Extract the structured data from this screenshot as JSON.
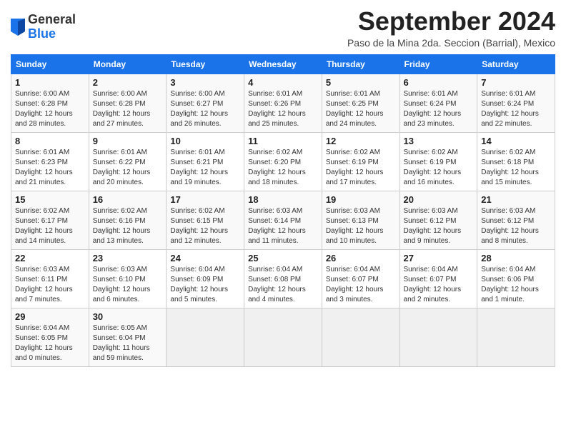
{
  "logo": {
    "general": "General",
    "blue": "Blue"
  },
  "title": "September 2024",
  "location": "Paso de la Mina 2da. Seccion (Barrial), Mexico",
  "days_of_week": [
    "Sunday",
    "Monday",
    "Tuesday",
    "Wednesday",
    "Thursday",
    "Friday",
    "Saturday"
  ],
  "weeks": [
    [
      {
        "day": "1",
        "sunrise": "6:00 AM",
        "sunset": "6:28 PM",
        "daylight": "12 hours and 28 minutes."
      },
      {
        "day": "2",
        "sunrise": "6:00 AM",
        "sunset": "6:28 PM",
        "daylight": "12 hours and 27 minutes."
      },
      {
        "day": "3",
        "sunrise": "6:00 AM",
        "sunset": "6:27 PM",
        "daylight": "12 hours and 26 minutes."
      },
      {
        "day": "4",
        "sunrise": "6:01 AM",
        "sunset": "6:26 PM",
        "daylight": "12 hours and 25 minutes."
      },
      {
        "day": "5",
        "sunrise": "6:01 AM",
        "sunset": "6:25 PM",
        "daylight": "12 hours and 24 minutes."
      },
      {
        "day": "6",
        "sunrise": "6:01 AM",
        "sunset": "6:24 PM",
        "daylight": "12 hours and 23 minutes."
      },
      {
        "day": "7",
        "sunrise": "6:01 AM",
        "sunset": "6:24 PM",
        "daylight": "12 hours and 22 minutes."
      }
    ],
    [
      {
        "day": "8",
        "sunrise": "6:01 AM",
        "sunset": "6:23 PM",
        "daylight": "12 hours and 21 minutes."
      },
      {
        "day": "9",
        "sunrise": "6:01 AM",
        "sunset": "6:22 PM",
        "daylight": "12 hours and 20 minutes."
      },
      {
        "day": "10",
        "sunrise": "6:01 AM",
        "sunset": "6:21 PM",
        "daylight": "12 hours and 19 minutes."
      },
      {
        "day": "11",
        "sunrise": "6:02 AM",
        "sunset": "6:20 PM",
        "daylight": "12 hours and 18 minutes."
      },
      {
        "day": "12",
        "sunrise": "6:02 AM",
        "sunset": "6:19 PM",
        "daylight": "12 hours and 17 minutes."
      },
      {
        "day": "13",
        "sunrise": "6:02 AM",
        "sunset": "6:19 PM",
        "daylight": "12 hours and 16 minutes."
      },
      {
        "day": "14",
        "sunrise": "6:02 AM",
        "sunset": "6:18 PM",
        "daylight": "12 hours and 15 minutes."
      }
    ],
    [
      {
        "day": "15",
        "sunrise": "6:02 AM",
        "sunset": "6:17 PM",
        "daylight": "12 hours and 14 minutes."
      },
      {
        "day": "16",
        "sunrise": "6:02 AM",
        "sunset": "6:16 PM",
        "daylight": "12 hours and 13 minutes."
      },
      {
        "day": "17",
        "sunrise": "6:02 AM",
        "sunset": "6:15 PM",
        "daylight": "12 hours and 12 minutes."
      },
      {
        "day": "18",
        "sunrise": "6:03 AM",
        "sunset": "6:14 PM",
        "daylight": "12 hours and 11 minutes."
      },
      {
        "day": "19",
        "sunrise": "6:03 AM",
        "sunset": "6:13 PM",
        "daylight": "12 hours and 10 minutes."
      },
      {
        "day": "20",
        "sunrise": "6:03 AM",
        "sunset": "6:12 PM",
        "daylight": "12 hours and 9 minutes."
      },
      {
        "day": "21",
        "sunrise": "6:03 AM",
        "sunset": "6:12 PM",
        "daylight": "12 hours and 8 minutes."
      }
    ],
    [
      {
        "day": "22",
        "sunrise": "6:03 AM",
        "sunset": "6:11 PM",
        "daylight": "12 hours and 7 minutes."
      },
      {
        "day": "23",
        "sunrise": "6:03 AM",
        "sunset": "6:10 PM",
        "daylight": "12 hours and 6 minutes."
      },
      {
        "day": "24",
        "sunrise": "6:04 AM",
        "sunset": "6:09 PM",
        "daylight": "12 hours and 5 minutes."
      },
      {
        "day": "25",
        "sunrise": "6:04 AM",
        "sunset": "6:08 PM",
        "daylight": "12 hours and 4 minutes."
      },
      {
        "day": "26",
        "sunrise": "6:04 AM",
        "sunset": "6:07 PM",
        "daylight": "12 hours and 3 minutes."
      },
      {
        "day": "27",
        "sunrise": "6:04 AM",
        "sunset": "6:07 PM",
        "daylight": "12 hours and 2 minutes."
      },
      {
        "day": "28",
        "sunrise": "6:04 AM",
        "sunset": "6:06 PM",
        "daylight": "12 hours and 1 minute."
      }
    ],
    [
      {
        "day": "29",
        "sunrise": "6:04 AM",
        "sunset": "6:05 PM",
        "daylight": "12 hours and 0 minutes."
      },
      {
        "day": "30",
        "sunrise": "6:05 AM",
        "sunset": "6:04 PM",
        "daylight": "11 hours and 59 minutes."
      },
      null,
      null,
      null,
      null,
      null
    ]
  ]
}
